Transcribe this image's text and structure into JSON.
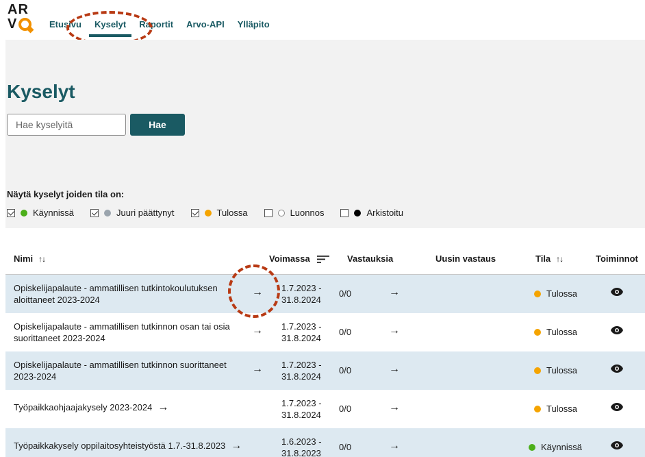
{
  "app": {
    "logo_line1": "AR",
    "logo_line2": "V"
  },
  "nav": [
    "Etusivu",
    "Kyselyt",
    "Raportit",
    "Arvo-API",
    "Ylläpito"
  ],
  "page_title": "Kyselyt",
  "search": {
    "placeholder": "Hae kyselyitä",
    "button": "Hae"
  },
  "filters": {
    "title": "Näytä kyselyt joiden tila on:",
    "items": [
      {
        "label": "Käynnissä",
        "checked": true,
        "color": "#4caf1a"
      },
      {
        "label": "Juuri päättynyt",
        "checked": true,
        "color": "#9aa4ad"
      },
      {
        "label": "Tulossa",
        "checked": true,
        "color": "#f5a400"
      },
      {
        "label": "Luonnos",
        "checked": false,
        "color": "#ffffff"
      },
      {
        "label": "Arkistoitu",
        "checked": false,
        "color": "#000000"
      }
    ]
  },
  "table": {
    "headers": {
      "name": "Nimi",
      "valid": "Voimassa",
      "responses": "Vastauksia",
      "latest": "Uusin vastaus",
      "status": "Tila",
      "actions": "Toiminnot"
    },
    "rows": [
      {
        "name": "Opiskelijapalaute - ammatillisen tutkintokoulutuksen aloittaneet 2023-2024",
        "date_start": "1.7.2023 -",
        "date_end": "31.8.2024",
        "responses": "0/0",
        "status": "Tulossa",
        "status_color": "#f5a400"
      },
      {
        "name": "Opiskelijapalaute - ammatillisen tutkinnon osan tai osia suorittaneet 2023-2024",
        "date_start": "1.7.2023 -",
        "date_end": "31.8.2024",
        "responses": "0/0",
        "status": "Tulossa",
        "status_color": "#f5a400"
      },
      {
        "name": "Opiskelijapalaute - ammatillisen tutkinnon suorittaneet 2023-2024",
        "date_start": "1.7.2023 -",
        "date_end": "31.8.2024",
        "responses": "0/0",
        "status": "Tulossa",
        "status_color": "#f5a400"
      },
      {
        "name": "Työpaikkaohjaajakysely 2023-2024",
        "date_start": "1.7.2023 -",
        "date_end": "31.8.2024",
        "responses": "0/0",
        "status": "Tulossa",
        "status_color": "#f5a400"
      },
      {
        "name": "Työpaikkakysely oppilaitosyhteistyöstä 1.7.-31.8.2023",
        "date_start": "1.6.2023 -",
        "date_end": "31.8.2023",
        "responses": "0/0",
        "status": "Käynnissä",
        "status_color": "#4caf1a"
      }
    ]
  },
  "colors": {
    "primary": "#1a5a63",
    "accent": "#f29100",
    "row_alt": "#dde9f1",
    "annotation": "#b83a14"
  },
  "icons": {
    "arrow": "arrow-right-icon",
    "eye": "eye-icon",
    "sort": "sort-icon",
    "sort_lines": "sort-lines-icon"
  }
}
